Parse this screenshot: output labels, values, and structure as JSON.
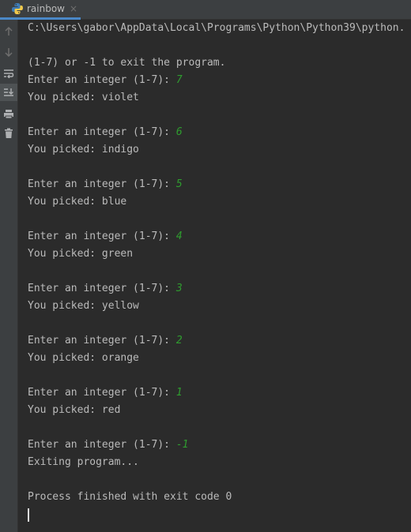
{
  "tab": {
    "label": "rainbow",
    "close_symbol": "×"
  },
  "toolbar": {
    "icons": [
      "arrow-up-icon",
      "arrow-down-icon",
      "soft-wrap-icon",
      "scroll-to-end-icon",
      "print-icon",
      "trash-icon"
    ]
  },
  "console": {
    "path_line": "C:\\Users\\gabor\\AppData\\Local\\Programs\\Python\\Python39\\python.",
    "instructions": "(1-7) or -1 to exit the program.",
    "prompt": "Enter an integer (1-7): ",
    "entries": [
      {
        "input": "7",
        "result": "You picked: violet"
      },
      {
        "input": "6",
        "result": "You picked: indigo"
      },
      {
        "input": "5",
        "result": "You picked: blue"
      },
      {
        "input": "4",
        "result": "You picked: green"
      },
      {
        "input": "3",
        "result": "You picked: yellow"
      },
      {
        "input": "2",
        "result": "You picked: orange"
      },
      {
        "input": "1",
        "result": "You picked: red"
      },
      {
        "input": "-1",
        "result": "Exiting program..."
      }
    ],
    "finish_line": "Process finished with exit code 0"
  },
  "colors": {
    "background": "#2b2b2b",
    "text": "#bbbbbb",
    "user_input": "#2f9d2f",
    "tab_accent": "#4a88c7"
  }
}
